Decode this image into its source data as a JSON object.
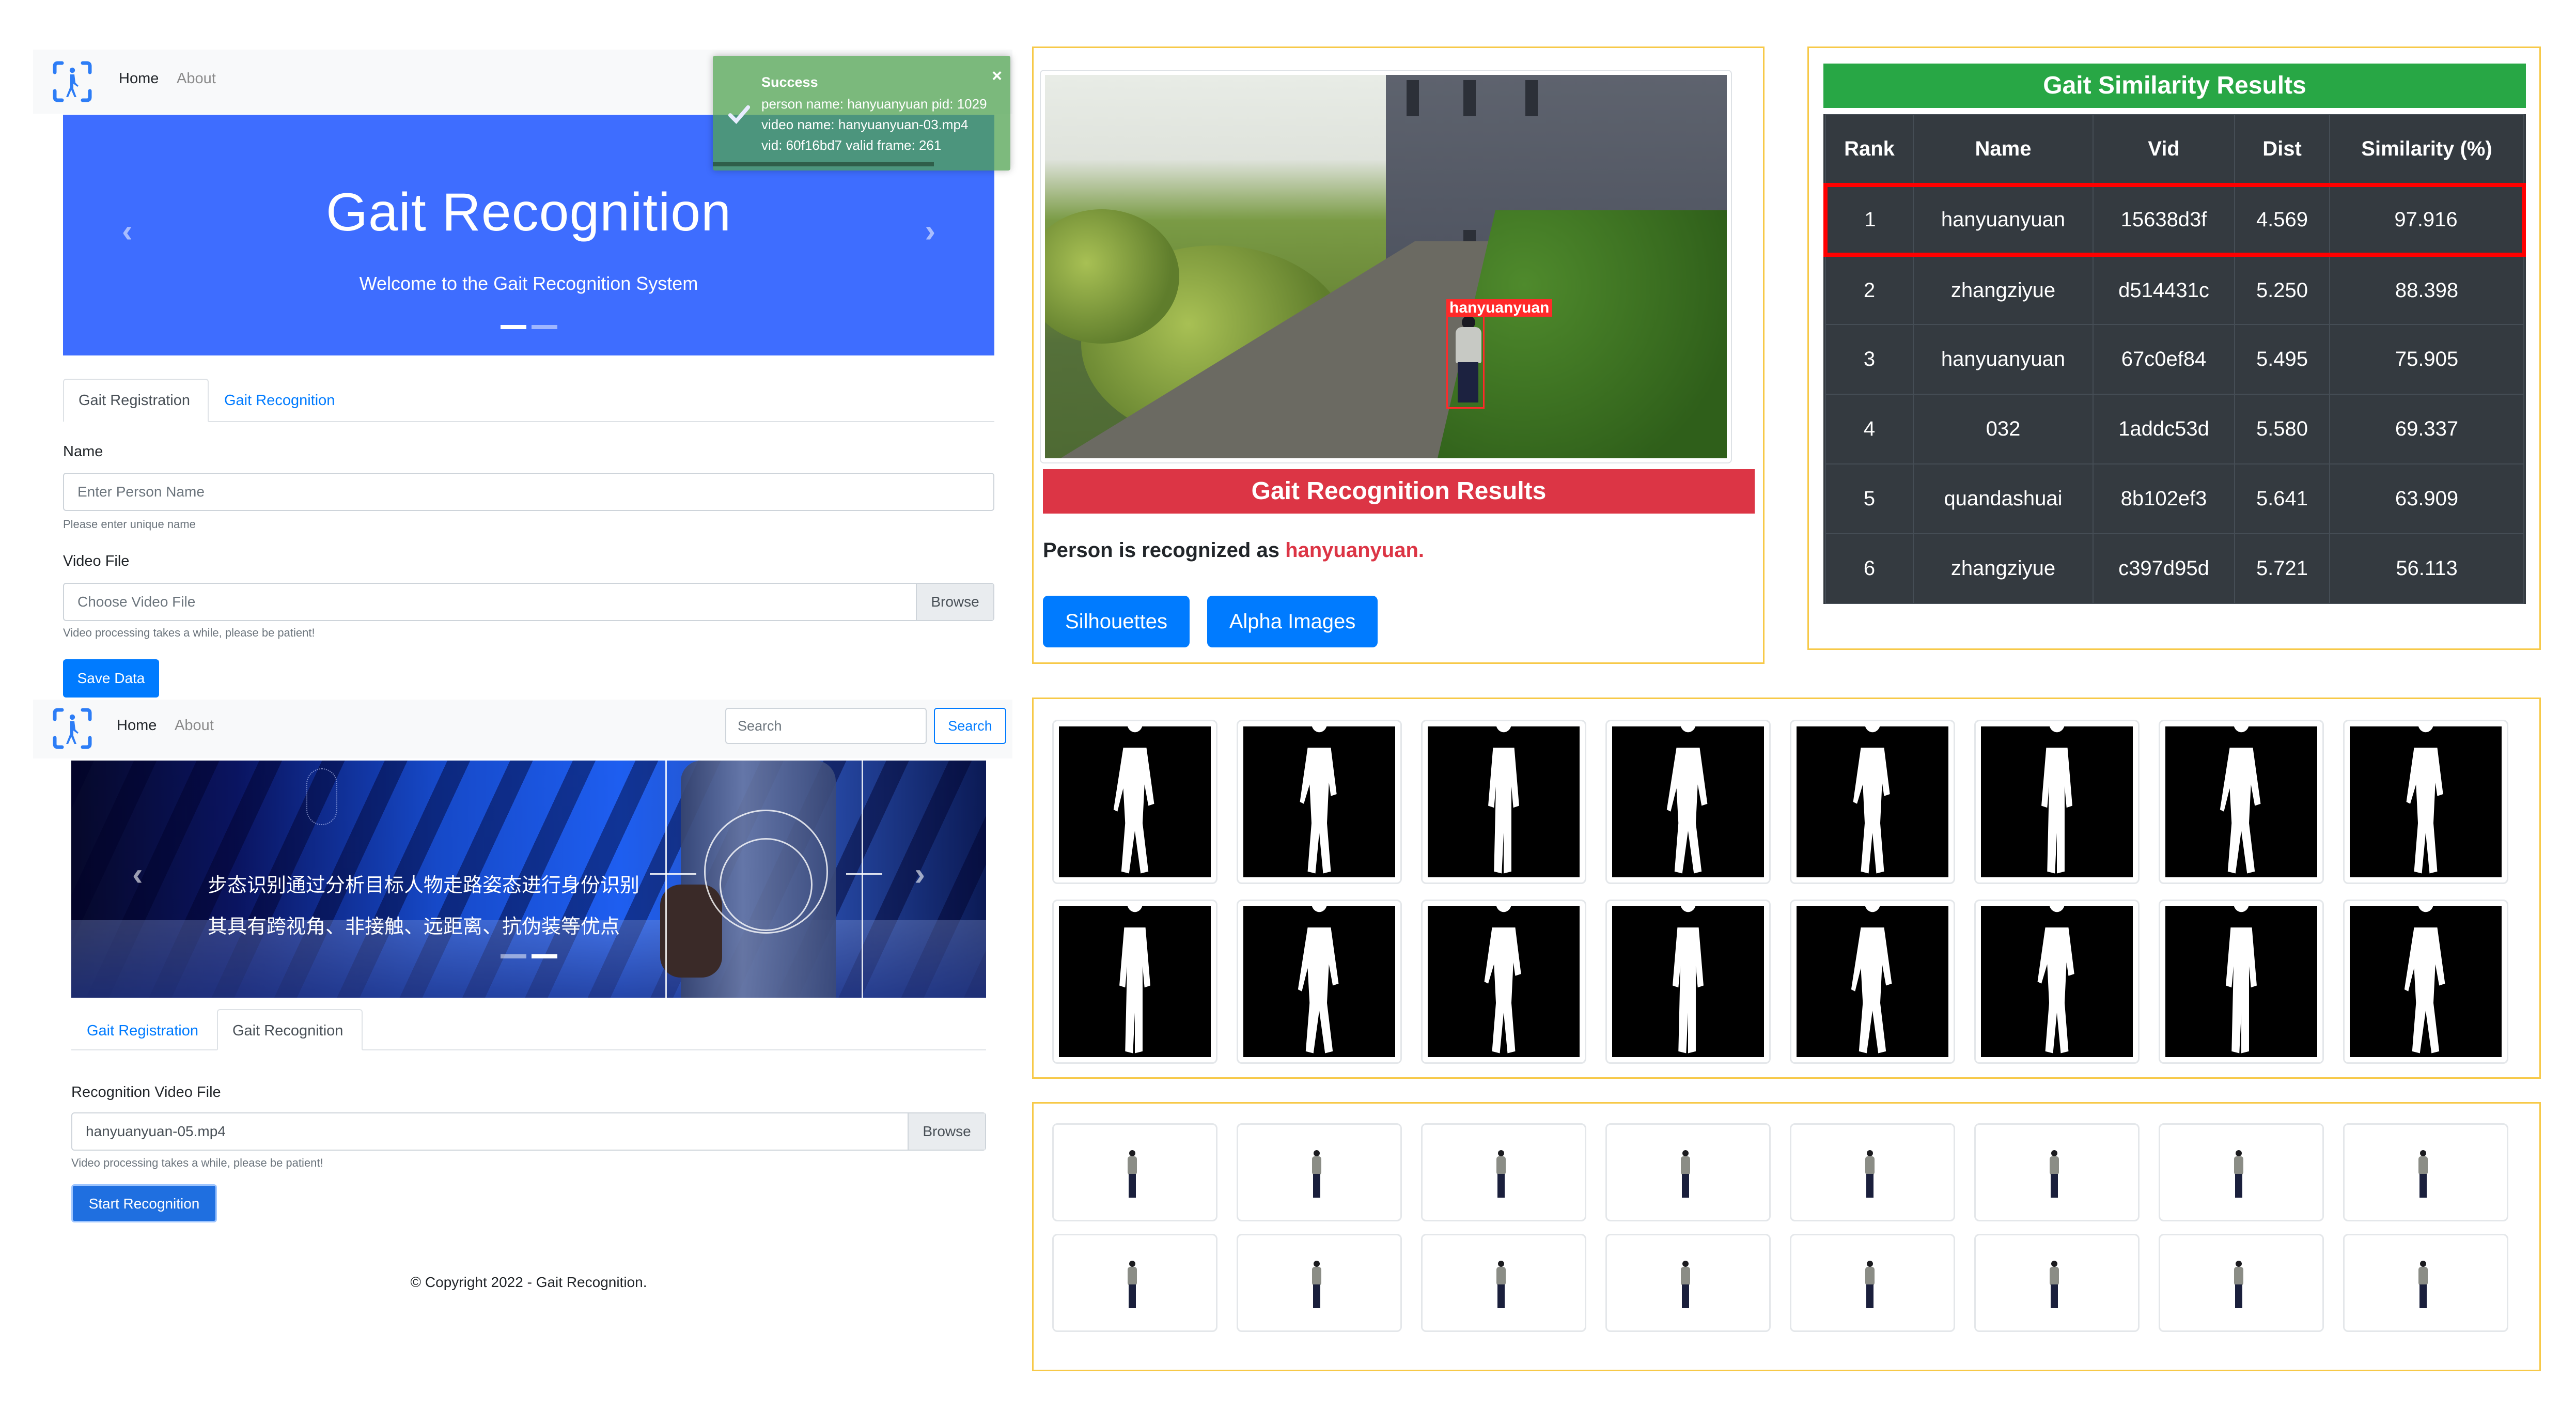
{
  "registration_page": {
    "nav": {
      "home": "Home",
      "about": "About"
    },
    "toast": {
      "title": "Success",
      "lines": [
        "person name: hanyuanyuan pid: 1029",
        "video name: hanyuanyuan-03.mp4",
        "vid: 60f16bd7 valid frame: 261"
      ],
      "close": "×",
      "icon": "check-icon"
    },
    "hero": {
      "title": "Gait Recognition",
      "subtitle": "Welcome to the Gait Recognition System",
      "prev": "‹",
      "next": "›",
      "slides": 2,
      "active_slide": 1
    },
    "tabs": [
      {
        "label": "Gait Registration",
        "active": true
      },
      {
        "label": "Gait Recognition",
        "active": false
      }
    ],
    "form": {
      "name_label": "Name",
      "name_placeholder": "Enter Person Name",
      "name_help": "Please enter unique name",
      "video_label": "Video File",
      "video_placeholder": "Choose Video File",
      "browse": "Browse",
      "video_help": "Video processing takes a while, please be patient!",
      "save_button": "Save Data"
    }
  },
  "recognition_page": {
    "nav": {
      "home": "Home",
      "about": "About",
      "search_placeholder": "Search",
      "search_button": "Search"
    },
    "banner": {
      "line1": "步态识别通过分析目标人物走路姿态进行身份识别",
      "line2": "其具有跨视角、非接触、远距离、抗伪装等优点",
      "prev": "‹",
      "next": "›",
      "slides": 2,
      "active_slide": 2
    },
    "tabs": [
      {
        "label": "Gait Registration",
        "active": false
      },
      {
        "label": "Gait Recognition",
        "active": true
      }
    ],
    "form": {
      "video_label": "Recognition Video File",
      "video_value": "hanyuanyuan-05.mp4",
      "browse": "Browse",
      "video_help": "Video processing takes a while, please be patient!",
      "start_button": "Start Recognition"
    },
    "footer": "© Copyright 2022 - Gait Recognition."
  },
  "result_panel": {
    "detection_label": "hanyuanyuan",
    "header": "Gait Recognition Results",
    "recognized_prefix": "Person is recognized as ",
    "recognized_name": "hanyuanyuan.",
    "buttons": {
      "silhouettes": "Silhouettes",
      "alpha_images": "Alpha Images"
    }
  },
  "similarity": {
    "title": "Gait Similarity Results",
    "columns": [
      "Rank",
      "Name",
      "Vid",
      "Dist",
      "Similarity (%)"
    ],
    "rows": [
      {
        "rank": "1",
        "name": "hanyuanyuan",
        "vid": "15638d3f",
        "dist": "4.569",
        "similarity": "97.916",
        "highlighted": true
      },
      {
        "rank": "2",
        "name": "zhangziyue",
        "vid": "d514431c",
        "dist": "5.250",
        "similarity": "88.398"
      },
      {
        "rank": "3",
        "name": "hanyuanyuan",
        "vid": "67c0ef84",
        "dist": "5.495",
        "similarity": "75.905"
      },
      {
        "rank": "4",
        "name": "032",
        "vid": "1addc53d",
        "dist": "5.580",
        "similarity": "69.337"
      },
      {
        "rank": "5",
        "name": "quandashuai",
        "vid": "8b102ef3",
        "dist": "5.641",
        "similarity": "63.909"
      },
      {
        "rank": "6",
        "name": "zhangziyue",
        "vid": "c397d95d",
        "dist": "5.721",
        "similarity": "56.113"
      }
    ]
  },
  "silhouettes": {
    "count": 16
  },
  "alpha_images": {
    "count": 16
  },
  "colors": {
    "primary": "#007bff",
    "hero_blue": "#3e6dff",
    "success_green": "#28a745",
    "danger_red": "#dc3545",
    "highlight_red": "#ff0000",
    "table_dark": "#343a40",
    "box_border": "#f7c948",
    "toast_green": "#51a351"
  }
}
